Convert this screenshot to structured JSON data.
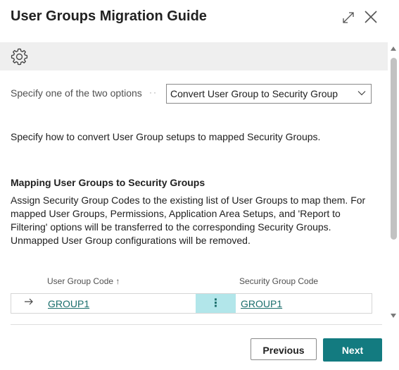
{
  "dialog": {
    "title": "User Groups Migration Guide",
    "icons": {
      "expand": "expand-icon",
      "close": "close-icon",
      "settings": "gear-icon"
    }
  },
  "options": {
    "label": "Specify one of the two options",
    "selected": "Convert User Group to Security Group"
  },
  "description": "Specify how to convert User Group setups to mapped Security Groups.",
  "mapping": {
    "heading": "Mapping User Groups to Security Groups",
    "body": "Assign Security Group Codes to the existing list of User Groups to map them. For mapped User Groups, Permissions, Application Area Setups, and 'Report to Filtering' options will be transferred to the corresponding Security Groups. Unmapped User Group configurations will be removed."
  },
  "table": {
    "columns": {
      "user_group_code": "User Group Code ↑",
      "security_group_code": "Security Group Code"
    },
    "rows": [
      {
        "user_group_code": "GROUP1",
        "actions": "⋮",
        "security_group_code": "GROUP1"
      }
    ]
  },
  "buttons": {
    "previous": "Previous",
    "next": "Next"
  },
  "colors": {
    "accent": "#137b80",
    "link": "#1a6e6c",
    "selected_cell": "#b2e6ea",
    "toolbar_bg": "#efefef"
  }
}
